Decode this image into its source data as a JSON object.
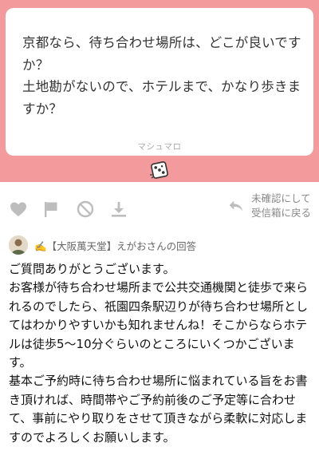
{
  "question": {
    "lines": [
      "京都なら、待ち合わせ場所は、どこが良いですか？",
      "土地勘がないので、ホテルまで、かなり歩きますか？"
    ],
    "brand": "マシュマロ"
  },
  "actions": {
    "like": "heart-icon",
    "report": "flag-icon",
    "block": "block-icon",
    "download": "download-icon",
    "unconfirm_line1": "未確認にして",
    "unconfirm_line2": "受信箱に戻る"
  },
  "answer": {
    "answerer_label": "✍️【大阪萬天堂】えがおさんの回答",
    "paragraphs": [
      "ご質問ありがとうございます。",
      "お客様が待ち合わせ場所まで公共交通機関と徒歩で来られるのでしたら、祇園四条駅辺りが待ち合わせ場所としてはわかりやすいかも知れませんね！そこからならホテルは徒歩5〜10分ぐらいのところにいくつかございます。",
      "基本ご予約時に待ち合わせ場所に悩まれている旨をお書き頂ければ、時間帯やご予約前後のご予定等に合わせて、事前にやり取りをさせて頂きながら柔軟に対応しますのでよろしくお願いします。"
    ]
  },
  "colors": {
    "band": "#f29a9c",
    "icon": "#bdbdbd"
  }
}
